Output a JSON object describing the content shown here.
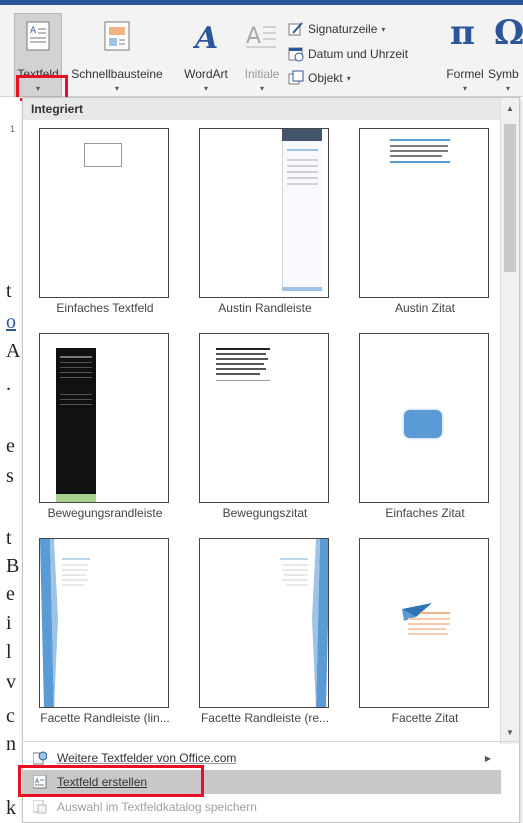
{
  "ribbon": {
    "textfeld_label": "Textfeld",
    "schnellbausteine_label": "Schnellbausteine",
    "wordart_label": "WordArt",
    "initiale_label": "Initiale",
    "signaturzeile_label": "Signaturzeile",
    "datum_label": "Datum und Uhrzeit",
    "objekt_label": "Objekt",
    "formel_label": "Formel",
    "symbol_label": "Symb",
    "dropdown_caret": "▾"
  },
  "document": {
    "ruler_number": "1",
    "visible_chars": [
      "t",
      "o",
      "A",
      ".",
      "e",
      "s",
      "t",
      "B",
      "e",
      "i",
      "l",
      "v",
      "c",
      "n",
      "k"
    ]
  },
  "gallery": {
    "section_header": "Integriert",
    "tiles": [
      {
        "label": "Einfaches Textfeld"
      },
      {
        "label": "Austin Randleiste"
      },
      {
        "label": "Austin Zitat"
      },
      {
        "label": "Bewegungsrandleiste"
      },
      {
        "label": "Bewegungszitat"
      },
      {
        "label": "Einfaches Zitat"
      },
      {
        "label": "Facette Randleiste (lin..."
      },
      {
        "label": "Facette Randleiste (re..."
      },
      {
        "label": "Facette Zitat"
      }
    ]
  },
  "menu": {
    "more_textboxes": "Weitere Textfelder von Office.com",
    "create_textbox": "Textfeld erstellen",
    "save_selection": "Auswahl im Textfeldkatalog speichern"
  },
  "colors": {
    "accent": "#2b579a",
    "highlight_red": "#e81123",
    "facet_blue": "#5b9bd5",
    "facet_orange": "#f4b183",
    "bewegung_green": "#a9d18e"
  }
}
